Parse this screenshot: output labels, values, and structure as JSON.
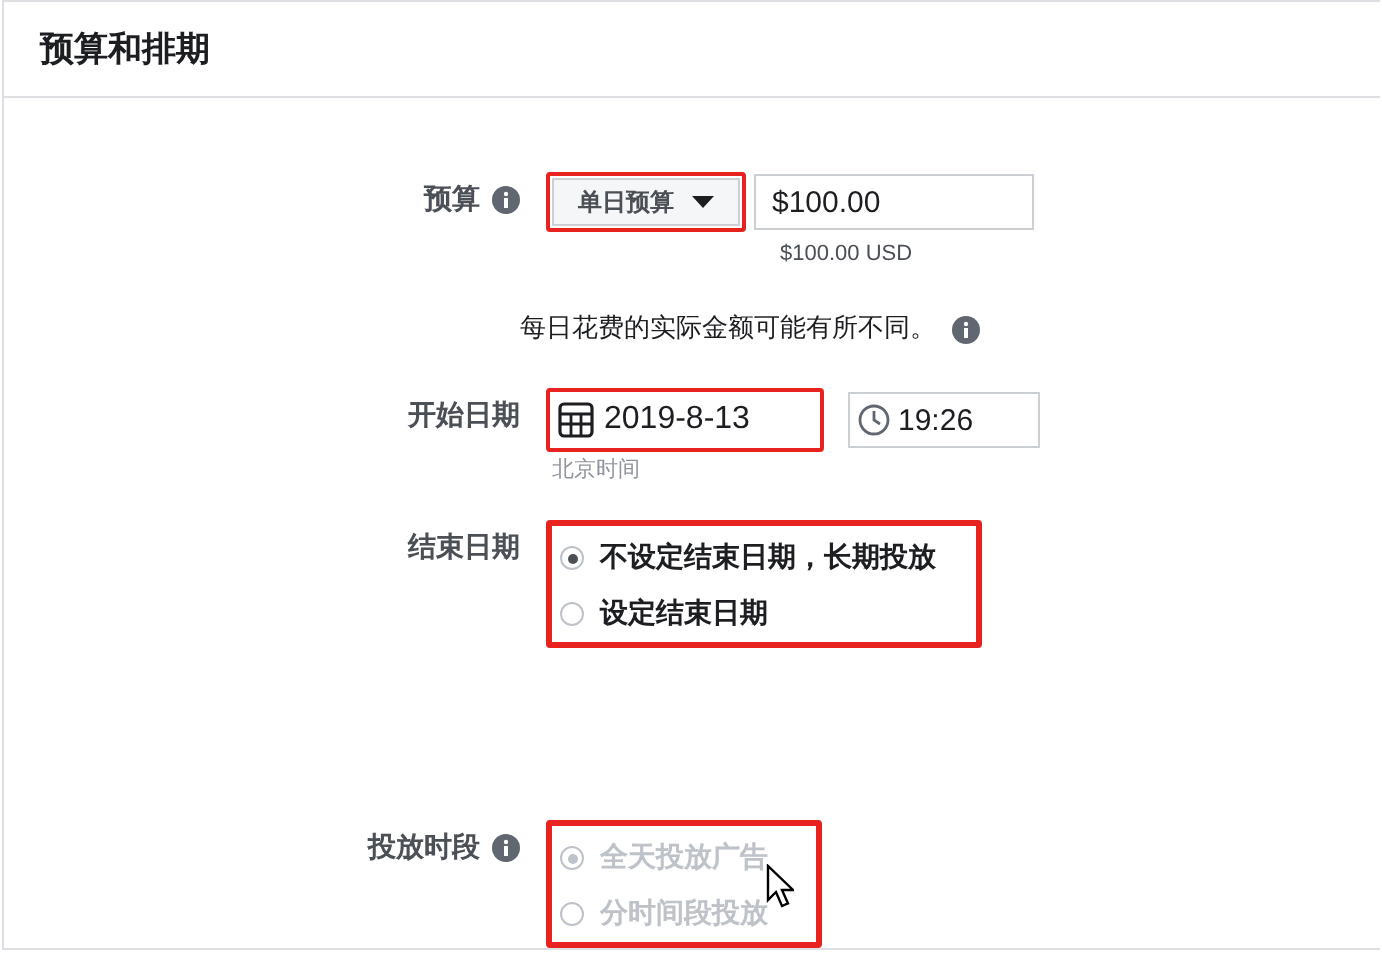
{
  "header": {
    "title": "预算和排期"
  },
  "budget": {
    "label": "预算",
    "type_button": "单日预算",
    "type_highlighted": true,
    "amount": "$100.00",
    "converted": "$100.00 USD",
    "note": "每日花费的实际金额可能有所不同。"
  },
  "start": {
    "label": "开始日期",
    "date": "2019-8-13",
    "date_highlighted": true,
    "time": "19:26",
    "timezone": "北京时间"
  },
  "end": {
    "label": "结束日期",
    "highlighted": true,
    "options": [
      {
        "label": "不设定结束日期，长期投放",
        "selected": true,
        "disabled": false
      },
      {
        "label": "设定结束日期",
        "selected": false,
        "disabled": false
      }
    ]
  },
  "schedule": {
    "label": "投放时段",
    "highlighted": true,
    "cursor": true,
    "options": [
      {
        "label": "全天投放广告",
        "selected": true,
        "disabled": true
      },
      {
        "label": "分时间段投放",
        "selected": false,
        "disabled": true
      }
    ]
  }
}
